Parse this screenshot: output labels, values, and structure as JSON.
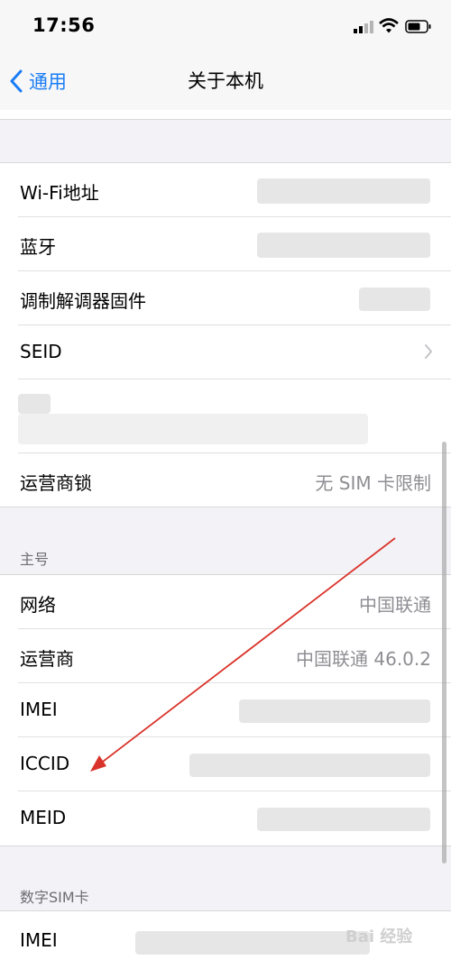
{
  "status_bar": {
    "time": "17:56"
  },
  "nav": {
    "back_label": "通用",
    "title": "关于本机"
  },
  "group1": {
    "rows": [
      {
        "label": "Wi-Fi地址"
      },
      {
        "label": "蓝牙"
      },
      {
        "label": "调制解调器固件"
      },
      {
        "label": "SEID"
      },
      {
        "label": "运营商锁",
        "value": "无 SIM 卡限制"
      }
    ]
  },
  "section_primary": {
    "header": "主号",
    "rows": [
      {
        "label": "网络",
        "value": "中国联通"
      },
      {
        "label": "运营商",
        "value": "中国联通 46.0.2"
      },
      {
        "label": "IMEI"
      },
      {
        "label": "ICCID"
      },
      {
        "label": "MEID"
      }
    ]
  },
  "section_esim": {
    "header": "数字SIM卡",
    "rows": [
      {
        "label": "IMEI"
      }
    ]
  },
  "watermark": {
    "text": "Bai 经验"
  },
  "colors": {
    "accent": "#1a7cf5",
    "annotation_arrow": "#d9342b"
  },
  "icons": [
    "signal-icon",
    "wifi-icon",
    "battery-icon",
    "chevron-left-icon",
    "chevron-right-icon"
  ]
}
